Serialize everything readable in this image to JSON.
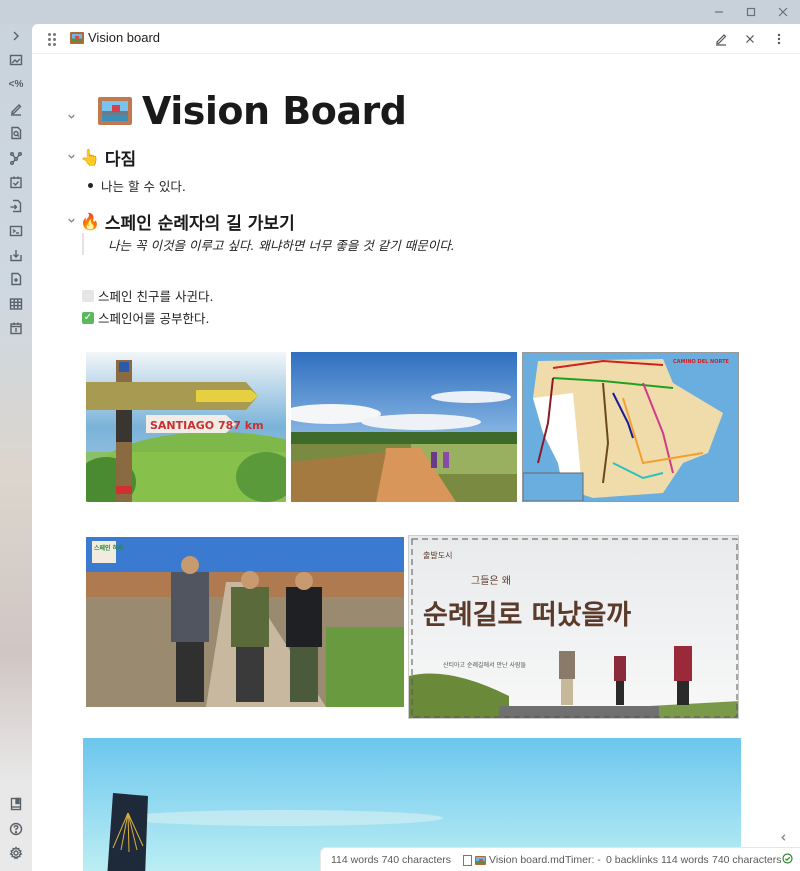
{
  "window": {
    "controls": [
      "minimize",
      "maximize",
      "close"
    ]
  },
  "ribbon": {
    "top_items": [
      {
        "name": "expand-sidebar-icon"
      },
      {
        "name": "image-icon"
      },
      {
        "name": "percent-code-icon",
        "label": "<%"
      },
      {
        "name": "pencil-icon"
      },
      {
        "name": "search-file-icon"
      },
      {
        "name": "graph-view-icon"
      },
      {
        "name": "calendar-check-icon"
      },
      {
        "name": "file-import-icon"
      },
      {
        "name": "terminal-icon"
      },
      {
        "name": "download-icon"
      },
      {
        "name": "new-file-icon"
      },
      {
        "name": "table-grid-icon"
      },
      {
        "name": "calendar-day-icon",
        "label": "1"
      }
    ],
    "bottom_items": [
      {
        "name": "vault-book-icon"
      },
      {
        "name": "help-icon",
        "label": "?"
      },
      {
        "name": "settings-gear-icon"
      }
    ]
  },
  "tab": {
    "title": "Vision board",
    "icon": "framed-picture-icon"
  },
  "header_actions": [
    "edit-pencil-icon",
    "close-icon",
    "more-options-icon"
  ],
  "document": {
    "h1": {
      "emoji": "🖼",
      "text": "Vision Board"
    },
    "sections": [
      {
        "heading": {
          "emoji": "👆",
          "text": "다짐"
        },
        "bullets": [
          "나는 할 수 있다."
        ]
      },
      {
        "heading": {
          "emoji": "🔥",
          "text": "스페인 순례자의 길 가보기"
        },
        "quote": "나는 꼭 이것을 이루고 싶다. 왜냐하면 너무 좋을 것 같기 때문이다."
      }
    ],
    "tasks": [
      {
        "text": "스페인 친구를 사귄다.",
        "done": false
      },
      {
        "text": "스페인어를 공부한다.",
        "done": true,
        "check": "✓"
      }
    ],
    "images": [
      {
        "name": "santiago-signpost-image",
        "caption_text": "SANTIAGO 787 km"
      },
      {
        "name": "camino-dirt-road-image"
      },
      {
        "name": "camino-routes-map-image",
        "map_label": "CAMINO DEL NORTE"
      },
      {
        "name": "spain-homestay-tv-image",
        "badge": "스페인 하숙"
      },
      {
        "name": "pilgrims-documentary-image",
        "tag": "출발도시",
        "headline_small": "그들은 왜",
        "headline": "순례길로 떠났을까",
        "subtitle": "산티아고 순례길에서 만난 사람들"
      },
      {
        "name": "camino-shell-marker-image"
      }
    ]
  },
  "collapse_right_icon": "chevron-left-icon",
  "status_bar": {
    "word_char_count": "114 words 740 characters",
    "file_name": "Vision board.md",
    "timer": "Timer: -",
    "backlinks": "0 backlinks",
    "words": "114 words",
    "characters": "740 characters",
    "sync_status": "synced-check-icon"
  }
}
